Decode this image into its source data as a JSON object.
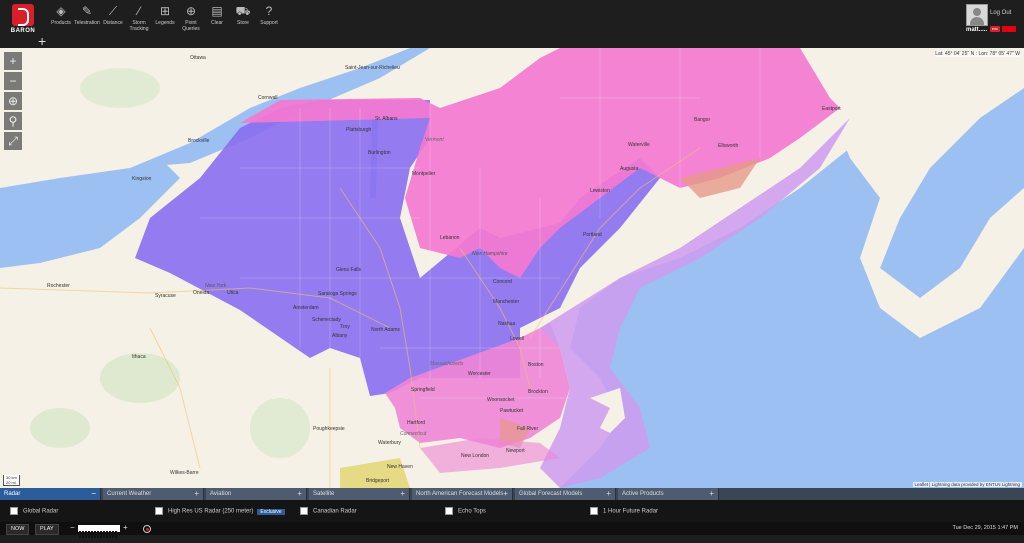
{
  "app": {
    "logo_text": "BARON"
  },
  "toolbar": [
    {
      "label": "Products",
      "icon": "layers-icon"
    },
    {
      "label": "Telestration",
      "icon": "pen-icon"
    },
    {
      "label": "Distance",
      "icon": "ruler-icon"
    },
    {
      "label": "Storm Tracking",
      "icon": "storm-icon"
    },
    {
      "label": "Legends",
      "icon": "grid-icon"
    },
    {
      "label": "Point Queries",
      "icon": "target-icon"
    },
    {
      "label": "Clear",
      "icon": "eraser-icon"
    },
    {
      "label": "Store",
      "icon": "cart-icon"
    },
    {
      "label": "Support",
      "icon": "help-icon"
    }
  ],
  "user": {
    "name": "matt.....",
    "logout_label": "Log Out",
    "badge": "exc"
  },
  "map": {
    "lat_lon": "Lat: 45° 04' 25'' N : Lon: 78° 05' 47'' W",
    "attribution": "Leaflet | Lightning data provided by ENTLN Lightning",
    "scale_km": "30 km",
    "scale_mi": "20 mi",
    "colors": {
      "ocean": "#9dc0f2",
      "land": "#f6f1e6",
      "winter_storm_watch": "#8a6ef0",
      "winter_weather_advisory": "#f37ad1",
      "winter_storm_warning": "#ee85d6",
      "freeze": "#ce9bef"
    },
    "labels": {
      "ottawa": "Ottawa",
      "saint_jean": "Saint-Jean-sur-Richelieu",
      "cornwall": "Cornwall",
      "brockville": "Brockville",
      "kingston": "Kingston",
      "st_albans": "St. Albans",
      "plattsburgh": "Plattsburgh",
      "burlington": "Burlington",
      "montpelier": "Montpelier",
      "vermont": "Vermont",
      "lebanon": "Lebanon",
      "new_hampshire": "New Hampshire",
      "concord": "Concord",
      "manchester": "Manchester",
      "nashua": "Nashua",
      "lowell": "Lowell",
      "boston": "Boston",
      "worcester": "Worcester",
      "brockton": "Brockton",
      "massachusetts": "Massachusetts",
      "springfield": "Springfield",
      "hartford": "Hartford",
      "connecticut": "Connecticut",
      "woonsocket": "Woonsocket",
      "pawtucket": "Pawtucket",
      "fall_river": "Fall River",
      "newport": "Newport",
      "new_london": "New London",
      "new_haven": "New Haven",
      "bridgeport": "Bridgeport",
      "waterbury": "Waterbury",
      "poughkeepsie": "Poughkeepsie",
      "wilkes_barre": "Wilkes-Barre",
      "ithaca": "Ithaca",
      "syracuse": "Syracuse",
      "rochester": "Rochester",
      "oneida": "Oneida",
      "utica": "Utica",
      "new_york": "New York",
      "glens_falls": "Glens Falls",
      "saratoga": "Saratoga Springs",
      "amsterdam": "Amsterdam",
      "schenectady": "Schenectady",
      "troy": "Troy",
      "albany": "Albany",
      "north_adams": "North Adams",
      "bangor": "Bangor",
      "waterville": "Waterville",
      "augusta": "Augusta",
      "ellsworth": "Ellsworth",
      "eastport": "Eastport",
      "lewiston": "Lewiston",
      "portland": "Portland"
    }
  },
  "tabs": [
    {
      "label": "Radar",
      "toggle": "−"
    },
    {
      "label": "Current Weather",
      "toggle": "+"
    },
    {
      "label": "Aviation",
      "toggle": "+"
    },
    {
      "label": "Satellite",
      "toggle": "+"
    },
    {
      "label": "North American Forecast Models",
      "toggle": "+"
    },
    {
      "label": "Global Forecast Models",
      "toggle": "+"
    },
    {
      "label": "Active Products",
      "toggle": "+"
    }
  ],
  "layers": [
    {
      "label": "Global Radar",
      "checked": false
    },
    {
      "label": "High Res US Radar (250 meter)",
      "checked": false,
      "tag": "Exclusive"
    },
    {
      "label": "Canadian Radar",
      "checked": false
    },
    {
      "label": "Echo Tops",
      "checked": false
    },
    {
      "label": "1 Hour Future Radar",
      "checked": false
    }
  ],
  "playback": {
    "now_label": "NOW",
    "play_label": "PLAY",
    "minus": "−",
    "plus": "+",
    "timestamp": "Tue Dec 29, 2015 1:47 PM"
  }
}
